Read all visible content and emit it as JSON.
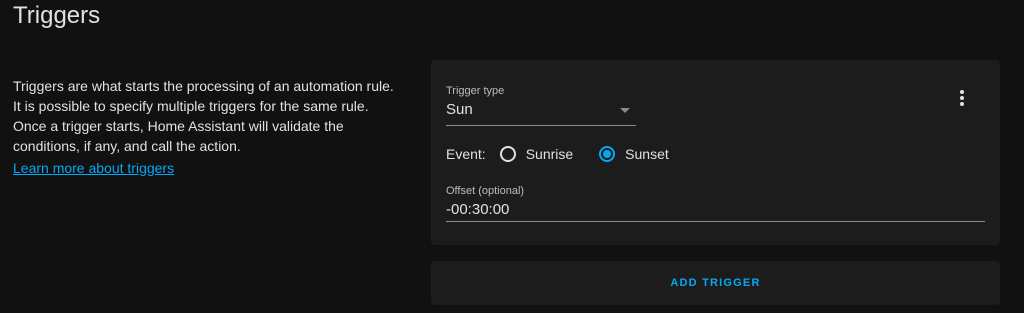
{
  "section": {
    "title": "Triggers"
  },
  "intro": {
    "text": "Triggers are what starts the processing of an automation rule. It is possible to specify multiple triggers for the same rule. Once a trigger starts, Home Assistant will validate the conditions, if any, and call the action.",
    "link_label": "Learn more about triggers"
  },
  "trigger_card": {
    "menu_icon": "dots-vertical-icon",
    "trigger_type": {
      "label": "Trigger type",
      "value": "Sun"
    },
    "event": {
      "label": "Event:",
      "options": [
        {
          "label": "Sunrise",
          "selected": false
        },
        {
          "label": "Sunset",
          "selected": true
        }
      ]
    },
    "offset": {
      "label": "Offset (optional)",
      "value": "-00:30:00"
    }
  },
  "add_trigger": {
    "label": "ADD TRIGGER"
  },
  "colors": {
    "background": "#111111",
    "card": "#1c1c1c",
    "accent": "#03a9f4",
    "text": "#e1e1e1"
  }
}
